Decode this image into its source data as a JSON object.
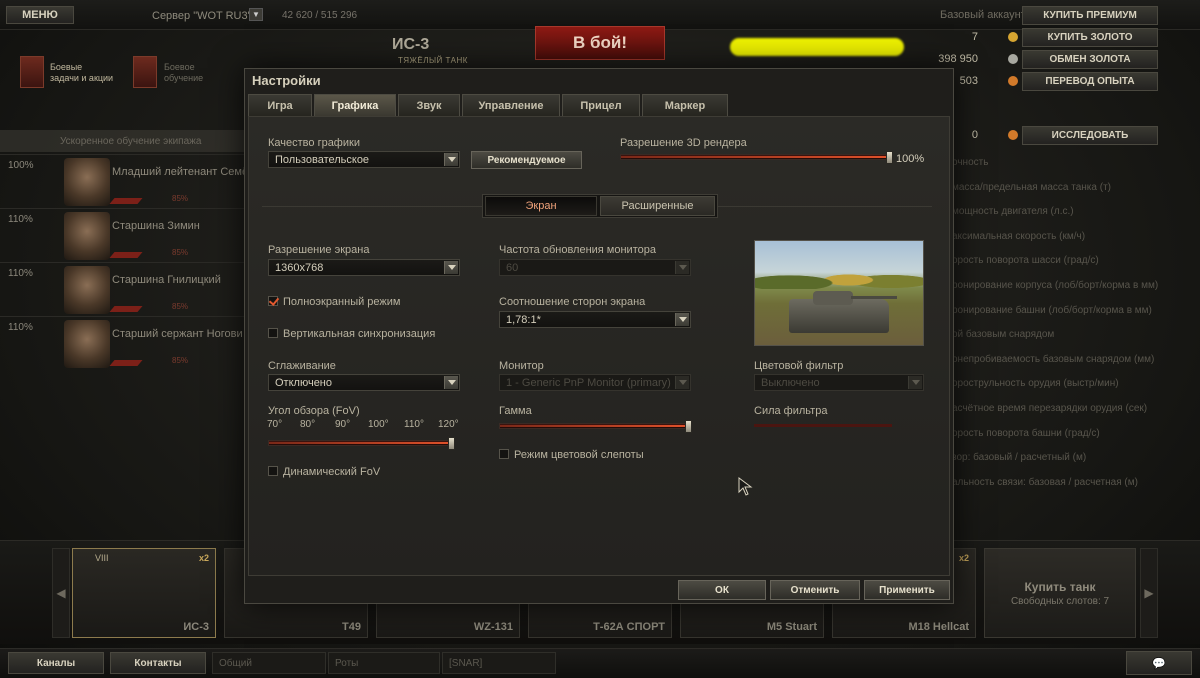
{
  "topbar": {
    "menu_label": "МЕНЮ",
    "server_label": "Сервер \"WOT RU3\"",
    "online": "42 620 / 515 296",
    "tank_name": "ИС-3",
    "tank_class": "ТЯЖЁЛЫЙ ТАНК",
    "battle_button": "В бой!",
    "account_type": "Базовый аккаунт",
    "buy_premium": "КУПИТЬ ПРЕМИУМ",
    "gold_value": "7",
    "buy_gold": "КУПИТЬ ЗОЛОТО",
    "credits_value": "398 950",
    "exchange_gold": "ОБМЕН ЗОЛОТА",
    "xp_value": "503",
    "transfer_xp": "ПЕРЕВОД ОПЫТА",
    "research_value": "0",
    "research": "ИССЛЕДОВАТЬ"
  },
  "missions": {
    "m1": "Боевые\nзадачи и акции",
    "m2": "Боевое\nобучение"
  },
  "crew": {
    "header": "Ускоренное обучение экипажа",
    "members": [
      {
        "pct": "100%",
        "name": "Младший лейтенант Семё",
        "skill": "85%"
      },
      {
        "pct": "110%",
        "name": "Старшина Зимин",
        "skill": "85%"
      },
      {
        "pct": "110%",
        "name": "Старшина Гнилицкий",
        "skill": "85%"
      },
      {
        "pct": "110%",
        "name": "Старший сержант Ногови",
        "skill": "85%"
      }
    ]
  },
  "right_stats": [
    "очность",
    "масса/предельная масса танка (т)",
    "мощность двигателя (л.с.)",
    "аксимальная скорость (км/ч)",
    "орость поворота шасси (град/с)",
    "ронирование корпуса (лоб/борт/корма в мм)",
    "ронирование башни (лоб/борт/корма в мм)",
    "ой базовым снарядом",
    "онепробиваемость базовым снарядом (мм)",
    "орострульность орудия (выстр/мин)",
    "асчётное время перезарядки орудия (сек)",
    "орость поворота башни (град/с)",
    "зор: базовый / расчетный (м)",
    "альность связи: базовая / расчетная (м)"
  ],
  "carousel": {
    "tanks": [
      {
        "name": "ИС-3",
        "tier": "VIII",
        "x2": "x2"
      },
      {
        "name": "T49",
        "tier": "",
        "x2": ""
      },
      {
        "name": "WZ-131",
        "tier": "",
        "x2": ""
      },
      {
        "name": "Т-62А СПОРТ",
        "tier": "",
        "x2": ""
      },
      {
        "name": "M5 Stuart",
        "tier": "",
        "x2": ""
      },
      {
        "name": "M18 Hellcat",
        "tier": "",
        "x2": "x2"
      }
    ],
    "buy_tank": "Купить танк",
    "free_slots": "Свободных слотов: 7"
  },
  "bottombar": {
    "channels": "Каналы",
    "contacts": "Контакты",
    "common": "Общий",
    "squads": "Роты",
    "clan": "[SNAR]"
  },
  "settings": {
    "title": "Настройки",
    "tabs": [
      "Игра",
      "Графика",
      "Звук",
      "Управление",
      "Прицел",
      "Маркер"
    ],
    "active_tab": "Графика",
    "quality_label": "Качество графики",
    "quality_value": "Пользовательское",
    "recommended_button": "Рекомендуемое",
    "render_label": "Разрешение 3D рендера",
    "render_value": "100%",
    "render_level": 1.0,
    "subtab_screen": "Экран",
    "subtab_advanced": "Расширенные",
    "resolution_label": "Разрешение экрана",
    "resolution_value": "1360x768",
    "fullscreen_label": "Полноэкранный режим",
    "fullscreen_checked": true,
    "vsync_label": "Вертикальная синхронизация",
    "vsync_checked": false,
    "aa_label": "Сглаживание",
    "aa_value": "Отключено",
    "fov_label": "Угол обзора (FoV)",
    "fov_ticks": [
      "70°",
      "80°",
      "90°",
      "100°",
      "110°",
      "120°"
    ],
    "fov_level": 1.0,
    "dynfov_label": "Динамический FoV",
    "refresh_label": "Частота обновления монитора",
    "refresh_value": "60",
    "aspect_label": "Соотношение сторон экрана",
    "aspect_value": "1,78:1*",
    "monitor_label": "Монитор",
    "monitor_value": "1 - Generic PnP Monitor (primary)",
    "gamma_label": "Гамма",
    "gamma_level": 1.0,
    "colorblind_label": "Режим цветовой слепоты",
    "color_filter_label": "Цветовой фильтр",
    "color_filter_value": "Выключено",
    "filter_strength_label": "Сила фильтра",
    "ok_button": "ОК",
    "cancel_button": "Отменить",
    "apply_button": "Применить"
  }
}
